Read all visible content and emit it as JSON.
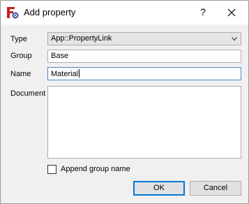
{
  "window": {
    "title": "Add property",
    "help_glyph": "?"
  },
  "form": {
    "type": {
      "label": "Type",
      "value": "App::PropertyLink"
    },
    "group": {
      "label": "Group",
      "value": "Base"
    },
    "name": {
      "label": "Name",
      "value": "Material"
    },
    "document": {
      "label": "Document",
      "value": ""
    }
  },
  "append_group_name": {
    "label": "Append group name",
    "checked": false
  },
  "buttons": {
    "ok": "OK",
    "cancel": "Cancel"
  },
  "colors": {
    "accent": "#0078d7",
    "focus_border": "#4a86c8",
    "dialog_bg": "#f0f0f0"
  },
  "icons": {
    "app": "freecad-logo-icon",
    "help": "help-icon",
    "close": "close-icon",
    "dropdown": "chevron-down-icon"
  }
}
